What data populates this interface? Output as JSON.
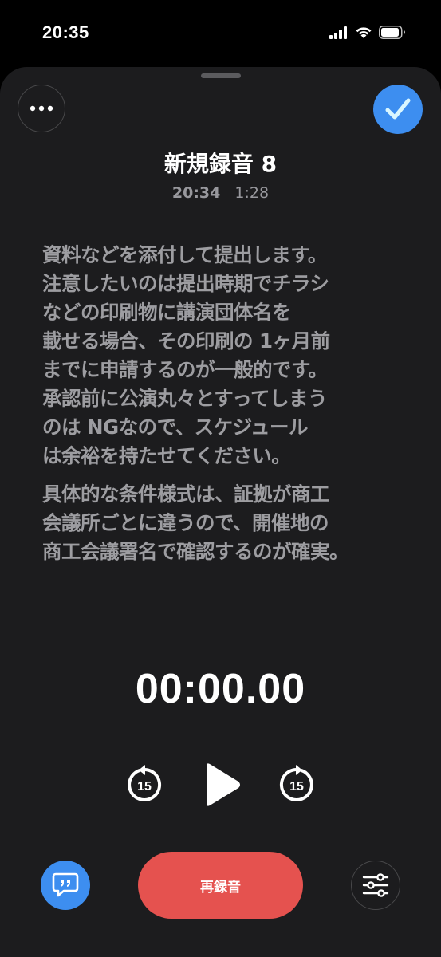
{
  "status_bar": {
    "time": "20:35",
    "icons": [
      "cellular-signal-icon",
      "wifi-icon",
      "battery-icon"
    ]
  },
  "header": {
    "more_icon": "ellipsis-icon",
    "done_icon": "checkmark-icon",
    "title": "新規録音 8",
    "recorded_time": "20:34",
    "duration": "1:28"
  },
  "transcript": {
    "paragraphs": [
      [
        "資料などを添付して提出します。",
        "注意したいのは提出時期でチラシ",
        "などの印刷物に講演団体名を",
        "載せる場合、その印刷の 1ヶ月前",
        "までに申請するのが一般的です。",
        "承認前に公演丸々とすってしまう",
        "のは NGなので、スケジュール",
        "は余裕を持たせてください。"
      ],
      [
        "具体的な条件様式は、証拠が商工",
        "会議所ごとに違うので、開催地の",
        "商工会議署名で確認するのが確実。"
      ]
    ]
  },
  "player": {
    "timer": "00:00.00",
    "skip_back_seconds": "15",
    "skip_forward_seconds": "15",
    "play_icon": "play-icon"
  },
  "footer": {
    "transcript_icon": "quote-bubble-icon",
    "rerecord_label": "再録音",
    "settings_icon": "sliders-icon"
  },
  "colors": {
    "background": "#000000",
    "sheet": "#1c1c1e",
    "accent_blue": "#3d8ef0",
    "record_red": "#e5524f",
    "text_secondary": "#9d9da1"
  }
}
